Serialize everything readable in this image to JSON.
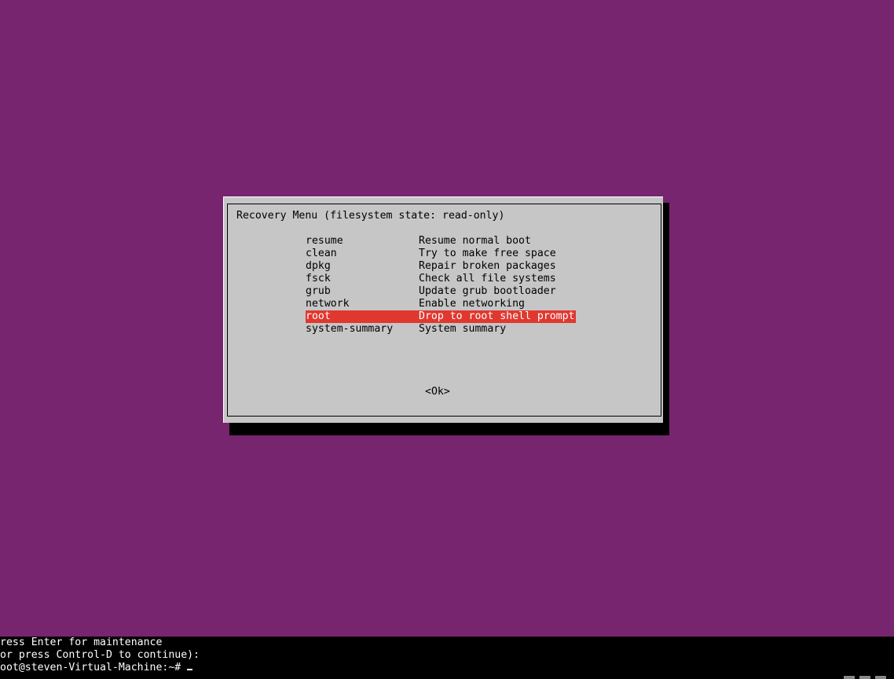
{
  "dialog": {
    "title": "Recovery Menu (filesystem state: read-only)",
    "items": [
      {
        "key": "resume",
        "desc": "Resume normal boot",
        "selected": false
      },
      {
        "key": "clean",
        "desc": "Try to make free space",
        "selected": false
      },
      {
        "key": "dpkg",
        "desc": "Repair broken packages",
        "selected": false
      },
      {
        "key": "fsck",
        "desc": "Check all file systems",
        "selected": false
      },
      {
        "key": "grub",
        "desc": "Update grub bootloader",
        "selected": false
      },
      {
        "key": "network",
        "desc": "Enable networking",
        "selected": false
      },
      {
        "key": "root",
        "desc": "Drop to root shell prompt",
        "selected": true
      },
      {
        "key": "system-summary",
        "desc": "System summary",
        "selected": false
      }
    ],
    "ok_label": "<Ok>"
  },
  "console": {
    "line1": "ress Enter for maintenance",
    "line2": "or press Control-D to continue):",
    "prompt": "oot@steven-Virtual-Machine:~# "
  },
  "colors": {
    "background": "#77256f",
    "dialog_bg": "#c6c6c6",
    "selected_bg": "#e0382f",
    "selected_fg": "#ffffff"
  }
}
